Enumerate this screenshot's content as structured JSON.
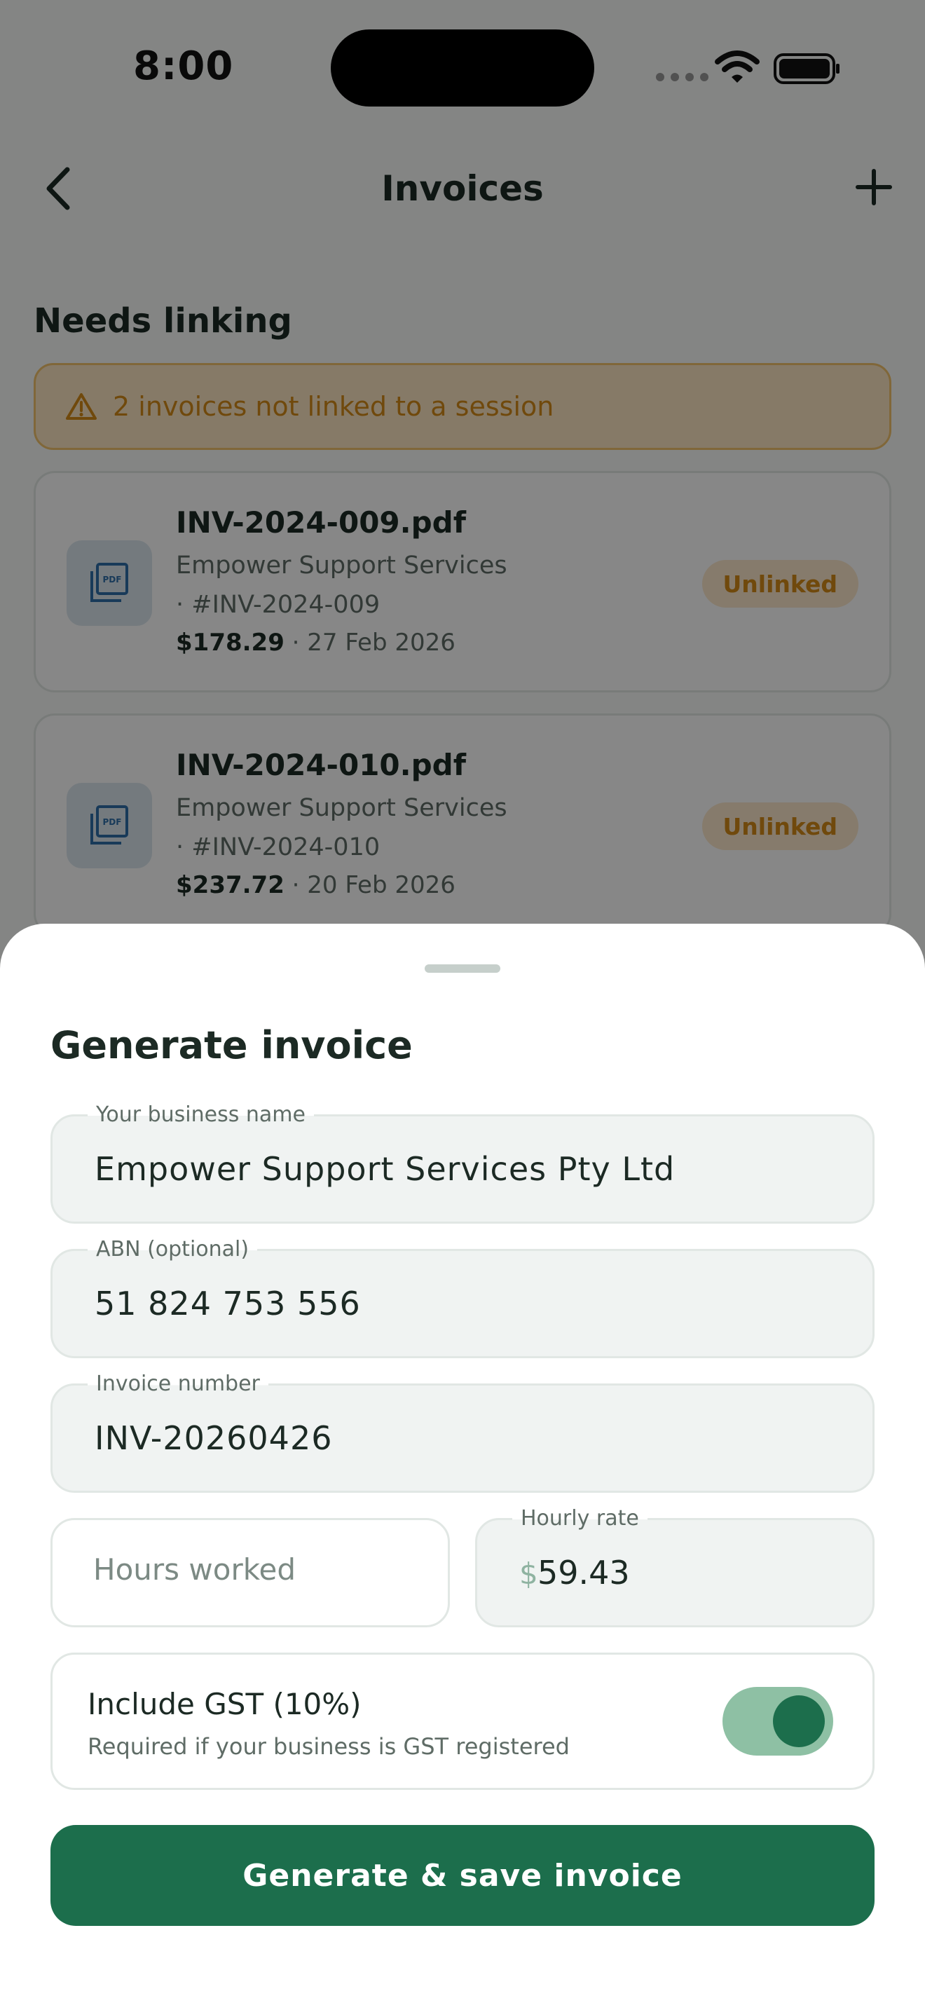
{
  "status_bar": {
    "time": "8:00"
  },
  "nav": {
    "title": "Invoices"
  },
  "section": {
    "title": "Needs linking"
  },
  "warning": {
    "text": "2 invoices not linked to a session"
  },
  "invoices": [
    {
      "file": "INV-2024-009.pdf",
      "vendor": "Empower Support Services",
      "ref": "· #INV-2024-009",
      "amount": "$178.29",
      "date": " · 27 Feb 2026",
      "status": "Unlinked"
    },
    {
      "file": "INV-2024-010.pdf",
      "vendor": "Empower Support Services",
      "ref": "· #INV-2024-010",
      "amount": "$237.72",
      "date": " · 20 Feb 2026",
      "status": "Unlinked"
    }
  ],
  "sheet": {
    "title": "Generate invoice",
    "business": {
      "label": "Your business name",
      "value": "Empower Support Services Pty Ltd"
    },
    "abn": {
      "label": "ABN (optional)",
      "value": "51 824 753 556"
    },
    "invoice_number": {
      "label": "Invoice number",
      "value": "INV-20260426"
    },
    "hours": {
      "placeholder": "Hours worked",
      "value": ""
    },
    "rate": {
      "label": "Hourly rate",
      "prefix": "$",
      "value": "59.43"
    },
    "gst": {
      "title": "Include GST (10%)",
      "subtitle": "Required if your business is GST registered",
      "enabled": true
    },
    "submit_label": "Generate & save invoice"
  },
  "colors": {
    "primary": "#1c6e4c",
    "warning": "#d38a17",
    "toggle_track": "#8ec0a4"
  }
}
